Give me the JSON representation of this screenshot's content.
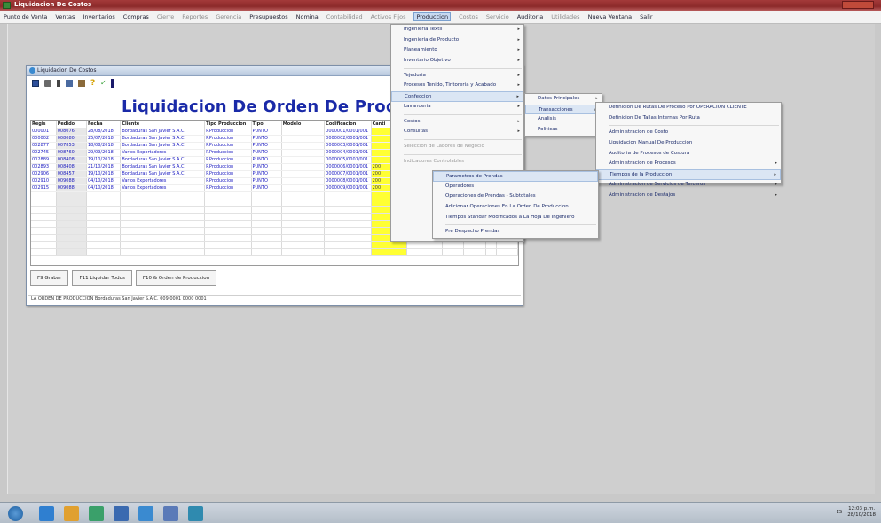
{
  "app": {
    "title": "Liquidacion De Costos"
  },
  "menubar": {
    "items": [
      {
        "label": "Punto de Venta",
        "dim": false
      },
      {
        "label": "Ventas",
        "dim": false
      },
      {
        "label": "Inventarios",
        "dim": false
      },
      {
        "label": "Compras",
        "dim": false
      },
      {
        "label": "Cierre",
        "dim": true
      },
      {
        "label": "Reportes",
        "dim": true
      },
      {
        "label": "Gerencia",
        "dim": true
      },
      {
        "label": "Presupuestos",
        "dim": false
      },
      {
        "label": "Nomina",
        "dim": false
      },
      {
        "label": "Contabilidad",
        "dim": true
      },
      {
        "label": "Activos Fijos",
        "dim": true
      },
      {
        "label": "Produccion",
        "dim": false,
        "active": true
      },
      {
        "label": "Costos",
        "dim": true
      },
      {
        "label": "Servicio",
        "dim": true
      },
      {
        "label": "Auditoria",
        "dim": false
      },
      {
        "label": "Utilidades",
        "dim": true
      },
      {
        "label": "Nueva Ventana",
        "dim": false
      },
      {
        "label": "Salir",
        "dim": false
      }
    ]
  },
  "window": {
    "title": "Liquidacion De Costos",
    "heading": "Liquidacion De Orden De Produc",
    "columns": [
      "Regis",
      "Pedido",
      "Fecha",
      "Cliente",
      "Tipo Produccion",
      "Tipo",
      "Modelo",
      "Codificacion",
      "Canti",
      "",
      "",
      "",
      "",
      "",
      ""
    ],
    "rows": [
      [
        "000001",
        "008076",
        "28/08/2018",
        "Bordaduras San Javier S.A.C.",
        "P.Produccion",
        "PUNTO",
        "",
        "0000001/0001/001",
        "",
        "",
        "",
        "",
        "",
        "",
        ""
      ],
      [
        "000002",
        "008080",
        "25/07/2018",
        "Bordaduras San Javier S.A.C.",
        "P.Produccion",
        "PUNTO",
        "",
        "0000002/0001/001",
        "",
        "",
        "",
        "",
        "",
        "",
        ""
      ],
      [
        "002877",
        "007853",
        "18/08/2018",
        "Bordaduras San Javier S.A.C.",
        "P.Produccion",
        "PUNTO",
        "",
        "0000003/0001/001",
        "",
        "",
        "",
        "",
        "",
        "",
        ""
      ],
      [
        "002745",
        "008760",
        "29/09/2018",
        "Varios Exportadores",
        "P.Produccion",
        "PUNTO",
        "",
        "0000004/0001/001",
        "",
        "",
        "",
        "",
        "",
        "",
        ""
      ],
      [
        "002889",
        "008408",
        "19/10/2018",
        "Bordaduras San Javier S.A.C.",
        "P.Produccion",
        "PUNTO",
        "",
        "0000005/0001/001",
        "",
        "",
        "",
        "",
        "",
        "",
        ""
      ],
      [
        "002893",
        "008408",
        "21/10/2018",
        "Bordaduras San Javier S.A.C.",
        "P.Produccion",
        "PUNTO",
        "",
        "0000006/0001/001",
        "200",
        "PRV/H002",
        "",
        "",
        "",
        "",
        ""
      ],
      [
        "002906",
        "008457",
        "19/10/2018",
        "Bordaduras San Javier S.A.C.",
        "P.Produccion",
        "PUNTO",
        "",
        "0000007/0001/001",
        "200",
        "PRV/H002",
        "",
        "",
        "",
        "",
        ""
      ],
      [
        "002910",
        "009088",
        "04/10/2018",
        "Varios Exportadores",
        "P.Produccion",
        "PUNTO",
        "",
        "0000008/0001/001",
        "200",
        "PRV/H002",
        "",
        "",
        "",
        "",
        ""
      ],
      [
        "002915",
        "009088",
        "04/10/2018",
        "Varios Exportadores",
        "P.Produccion",
        "PUNTO",
        "",
        "0000009/0001/001",
        "200",
        "PRV/H002",
        "",
        "",
        "",
        "",
        ""
      ]
    ],
    "empty_rows": 9,
    "buttons": {
      "b1": "F9 Grabar",
      "b2": "F11 Liquidar Todos",
      "b3": "F10 & Orden de Produccion"
    },
    "status": "LA ORDEN DE PRODUCCION Bordaduras San Javier S.A.C. 009 0001 0000 0001"
  },
  "menus": {
    "produccion": [
      {
        "label": "Ingenieria Textil",
        "sub": true
      },
      {
        "label": "Ingenieria de Producto",
        "sub": true
      },
      {
        "label": "Planeamiento",
        "sub": true
      },
      {
        "label": "Inventario Objetivo",
        "sub": true
      },
      {
        "sep": true
      },
      {
        "label": "Tejeduria",
        "sub": true
      },
      {
        "label": "Procesos Tenido, Tintoreria y Acabado",
        "sub": true
      },
      {
        "label": "Confeccion",
        "sub": true,
        "hl": true
      },
      {
        "label": "Lavanderia",
        "sub": true
      },
      {
        "sep": true
      },
      {
        "label": "Costos",
        "sub": true
      },
      {
        "label": "Consultas",
        "sub": true
      },
      {
        "sep": true
      },
      {
        "label": "Seleccion de Labores de Negocio",
        "dim": true
      },
      {
        "sep": true
      },
      {
        "label": "Indicadores Controlables",
        "dim": true
      }
    ],
    "confeccion": [
      {
        "label": "Datos Principales",
        "sub": true
      },
      {
        "label": "Transacciones",
        "sub": true,
        "hl": true
      },
      {
        "label": "Analisis",
        "sub": true
      },
      {
        "label": "Politicas",
        "sub": true
      }
    ],
    "transacciones": [
      {
        "label": "Definicion De Rutas De Proceso Por OPERACION CLIENTE",
        "sub": false
      },
      {
        "label": "Definicion De Tallas Internas Por Ruta",
        "sub": false
      },
      {
        "sep": true
      },
      {
        "label": "Administracion de Costo",
        "sub": false
      },
      {
        "label": "Liquidacion Manual De Produccion",
        "sub": false
      },
      {
        "label": "Auditoria de Procesos de Costura",
        "sub": false
      },
      {
        "label": "Administracion de Procesos",
        "sub": true
      },
      {
        "label": "Tiempos de la Produccion",
        "sub": true,
        "hl": true
      },
      {
        "label": "Administracion de Servicios de Terceros",
        "sub": true
      },
      {
        "label": "Administracion de Destajos",
        "sub": true
      }
    ],
    "tiempos": [
      {
        "label": "Parametros de Prendas",
        "hl": true
      },
      {
        "label": "Operadores"
      },
      {
        "label": "Operaciones de Prendas - Subtotales"
      },
      {
        "label": "Adicionar Operaciones En La Orden De Produccion"
      },
      {
        "label": "Tiempos Standar Modificados a La Hoja De Ingeniero"
      },
      {
        "sep": true
      },
      {
        "label": "Pre Despacho Prendas"
      }
    ]
  },
  "taskbar": {
    "tray": "ES",
    "time": "12:03 p.m.",
    "date": "28/10/2018"
  }
}
